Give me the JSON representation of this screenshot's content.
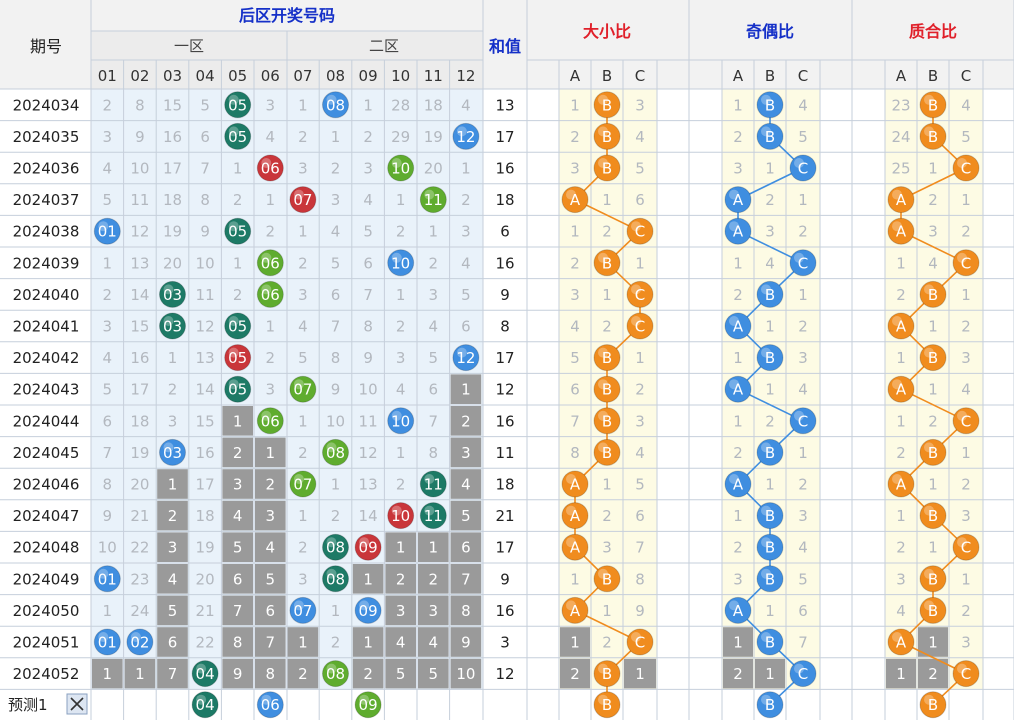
{
  "header": {
    "period": "期号",
    "back_zone": "后区开奖号码",
    "zone1": "一区",
    "zone2": "二区",
    "sum": "和值",
    "size_ratio": "大小比",
    "odd_even_ratio": "奇偶比",
    "prime_ratio": "质合比",
    "numbers": [
      "01",
      "02",
      "03",
      "04",
      "05",
      "06",
      "07",
      "08",
      "09",
      "10",
      "11",
      "12"
    ],
    "abc": [
      "A",
      "B",
      "C"
    ]
  },
  "colors": {
    "blue": "#3f8ee0",
    "teal": "#1d7a66",
    "red": "#c9363a",
    "green": "#5fac2e",
    "orange": "#f08c1e",
    "gray_cell": "#9a9a9a",
    "header_blue": "#1530c8",
    "header_red": "#e0202a",
    "number_bg": "#e9f2fa",
    "ratio_bg": "#fdfbe4"
  },
  "footer": {
    "label": "预测1",
    "close_icon": "close-icon",
    "back_balls": [
      "04",
      "06",
      "09"
    ],
    "size": "B",
    "odd_even": "B",
    "prime": "B"
  },
  "chart_data": {
    "type": "table",
    "rows": [
      {
        "period": "2024034",
        "cells": [
          "2",
          "8",
          "15",
          "5",
          "05",
          "3",
          "1",
          "08",
          "1",
          "28",
          "18",
          "4"
        ],
        "sum": "13",
        "size": [
          "1",
          "B",
          "3"
        ],
        "odd_even": [
          "1",
          "B",
          "4"
        ],
        "prime": [
          "23",
          "B",
          "4"
        ]
      },
      {
        "period": "2024035",
        "cells": [
          "3",
          "9",
          "16",
          "6",
          "05",
          "4",
          "2",
          "1",
          "2",
          "29",
          "19",
          "12"
        ],
        "sum": "17",
        "size": [
          "2",
          "B",
          "4"
        ],
        "odd_even": [
          "2",
          "B",
          "5"
        ],
        "prime": [
          "24",
          "B",
          "5"
        ]
      },
      {
        "period": "2024036",
        "cells": [
          "4",
          "10",
          "17",
          "7",
          "1",
          "06",
          "3",
          "2",
          "3",
          "10",
          "20",
          "1"
        ],
        "sum": "16",
        "size": [
          "3",
          "B",
          "5"
        ],
        "odd_even": [
          "3",
          "1",
          "C"
        ],
        "prime": [
          "25",
          "1",
          "C"
        ]
      },
      {
        "period": "2024037",
        "cells": [
          "5",
          "11",
          "18",
          "8",
          "2",
          "1",
          "07",
          "3",
          "4",
          "1",
          "11",
          "2"
        ],
        "sum": "18",
        "size": [
          "A",
          "1",
          "6"
        ],
        "odd_even": [
          "A",
          "2",
          "1"
        ],
        "prime": [
          "A",
          "2",
          "1"
        ]
      },
      {
        "period": "2024038",
        "cells": [
          "01",
          "12",
          "19",
          "9",
          "05",
          "2",
          "1",
          "4",
          "5",
          "2",
          "1",
          "3"
        ],
        "sum": "6",
        "size": [
          "1",
          "2",
          "C"
        ],
        "odd_even": [
          "A",
          "3",
          "2"
        ],
        "prime": [
          "A",
          "3",
          "2"
        ]
      },
      {
        "period": "2024039",
        "cells": [
          "1",
          "13",
          "20",
          "10",
          "1",
          "06",
          "2",
          "5",
          "6",
          "10",
          "2",
          "4"
        ],
        "sum": "16",
        "size": [
          "2",
          "B",
          "1"
        ],
        "odd_even": [
          "1",
          "4",
          "C"
        ],
        "prime": [
          "1",
          "4",
          "C"
        ]
      },
      {
        "period": "2024040",
        "cells": [
          "2",
          "14",
          "03",
          "11",
          "2",
          "06",
          "3",
          "6",
          "7",
          "1",
          "3",
          "5"
        ],
        "sum": "9",
        "size": [
          "3",
          "1",
          "C"
        ],
        "odd_even": [
          "2",
          "B",
          "1"
        ],
        "prime": [
          "2",
          "B",
          "1"
        ]
      },
      {
        "period": "2024041",
        "cells": [
          "3",
          "15",
          "03",
          "12",
          "05",
          "1",
          "4",
          "7",
          "8",
          "2",
          "4",
          "6"
        ],
        "sum": "8",
        "size": [
          "4",
          "2",
          "C"
        ],
        "odd_even": [
          "A",
          "1",
          "2"
        ],
        "prime": [
          "A",
          "1",
          "2"
        ]
      },
      {
        "period": "2024042",
        "cells": [
          "4",
          "16",
          "1",
          "13",
          "05",
          "2",
          "5",
          "8",
          "9",
          "3",
          "5",
          "12"
        ],
        "sum": "17",
        "size": [
          "5",
          "B",
          "1"
        ],
        "odd_even": [
          "1",
          "B",
          "3"
        ],
        "prime": [
          "1",
          "B",
          "3"
        ]
      },
      {
        "period": "2024043",
        "cells": [
          "5",
          "17",
          "2",
          "14",
          "05",
          "3",
          "07",
          "9",
          "10",
          "4",
          "6",
          "1"
        ],
        "sum": "12",
        "size": [
          "6",
          "B",
          "2"
        ],
        "odd_even": [
          "A",
          "1",
          "4"
        ],
        "prime": [
          "A",
          "1",
          "4"
        ]
      },
      {
        "period": "2024044",
        "cells": [
          "6",
          "18",
          "3",
          "15",
          "1",
          "06",
          "1",
          "10",
          "11",
          "10",
          "7",
          "2"
        ],
        "sum": "16",
        "size": [
          "7",
          "B",
          "3"
        ],
        "odd_even": [
          "1",
          "2",
          "C"
        ],
        "prime": [
          "1",
          "2",
          "C"
        ]
      },
      {
        "period": "2024045",
        "cells": [
          "7",
          "19",
          "03",
          "16",
          "2",
          "1",
          "2",
          "08",
          "12",
          "1",
          "8",
          "3"
        ],
        "sum": "11",
        "size": [
          "8",
          "B",
          "4"
        ],
        "odd_even": [
          "2",
          "B",
          "1"
        ],
        "prime": [
          "2",
          "B",
          "1"
        ]
      },
      {
        "period": "2024046",
        "cells": [
          "8",
          "20",
          "1",
          "17",
          "3",
          "2",
          "07",
          "1",
          "13",
          "2",
          "11",
          "4"
        ],
        "sum": "18",
        "size": [
          "A",
          "1",
          "5"
        ],
        "odd_even": [
          "A",
          "1",
          "2"
        ],
        "prime": [
          "A",
          "1",
          "2"
        ]
      },
      {
        "period": "2024047",
        "cells": [
          "9",
          "21",
          "2",
          "18",
          "4",
          "3",
          "1",
          "2",
          "14",
          "10",
          "11",
          "5"
        ],
        "sum": "21",
        "size": [
          "A",
          "2",
          "6"
        ],
        "odd_even": [
          "1",
          "B",
          "3"
        ],
        "prime": [
          "1",
          "B",
          "3"
        ]
      },
      {
        "period": "2024048",
        "cells": [
          "10",
          "22",
          "3",
          "19",
          "5",
          "4",
          "2",
          "08",
          "09",
          "1",
          "1",
          "6"
        ],
        "sum": "17",
        "size": [
          "A",
          "3",
          "7"
        ],
        "odd_even": [
          "2",
          "B",
          "4"
        ],
        "prime": [
          "2",
          "1",
          "C"
        ]
      },
      {
        "period": "2024049",
        "cells": [
          "01",
          "23",
          "4",
          "20",
          "6",
          "5",
          "3",
          "08",
          "1",
          "2",
          "2",
          "7"
        ],
        "sum": "9",
        "size": [
          "1",
          "B",
          "8"
        ],
        "odd_even": [
          "3",
          "B",
          "5"
        ],
        "prime": [
          "3",
          "B",
          "1"
        ]
      },
      {
        "period": "2024050",
        "cells": [
          "1",
          "24",
          "5",
          "21",
          "7",
          "6",
          "07",
          "1",
          "09",
          "3",
          "3",
          "8"
        ],
        "sum": "16",
        "size": [
          "A",
          "1",
          "9"
        ],
        "odd_even": [
          "A",
          "1",
          "6"
        ],
        "prime": [
          "4",
          "B",
          "2"
        ]
      },
      {
        "period": "2024051",
        "cells": [
          "01",
          "02",
          "6",
          "22",
          "8",
          "7",
          "1",
          "2",
          "1",
          "4",
          "4",
          "9"
        ],
        "sum": "3",
        "size": [
          "1",
          "2",
          "C"
        ],
        "odd_even": [
          "1",
          "B",
          "7"
        ],
        "prime": [
          "A",
          "1",
          "3"
        ]
      },
      {
        "period": "2024052",
        "cells": [
          "1",
          "1",
          "7",
          "04",
          "9",
          "8",
          "2",
          "08",
          "2",
          "5",
          "5",
          "10"
        ],
        "sum": "12",
        "size": [
          "2",
          "B",
          "1"
        ],
        "odd_even": [
          "2",
          "1",
          "C"
        ],
        "prime": [
          "1",
          "2",
          "C"
        ]
      }
    ],
    "gray_cells": [
      [
        9,
        11
      ],
      [
        10,
        4
      ],
      [
        10,
        11
      ],
      [
        11,
        4
      ],
      [
        11,
        5
      ],
      [
        11,
        11
      ],
      [
        12,
        2
      ],
      [
        12,
        4
      ],
      [
        12,
        5
      ],
      [
        12,
        11
      ],
      [
        13,
        2
      ],
      [
        13,
        4
      ],
      [
        13,
        5
      ],
      [
        13,
        11
      ],
      [
        14,
        2
      ],
      [
        14,
        4
      ],
      [
        14,
        5
      ],
      [
        14,
        9
      ],
      [
        14,
        10
      ],
      [
        14,
        11
      ],
      [
        15,
        2
      ],
      [
        15,
        4
      ],
      [
        15,
        5
      ],
      [
        15,
        8
      ],
      [
        15,
        9
      ],
      [
        15,
        10
      ],
      [
        15,
        11
      ],
      [
        16,
        2
      ],
      [
        16,
        4
      ],
      [
        16,
        5
      ],
      [
        16,
        9
      ],
      [
        16,
        10
      ],
      [
        16,
        11
      ],
      [
        17,
        2
      ],
      [
        17,
        4
      ],
      [
        17,
        5
      ],
      [
        17,
        6
      ],
      [
        17,
        8
      ],
      [
        17,
        9
      ],
      [
        17,
        10
      ],
      [
        17,
        11
      ],
      [
        18,
        0
      ],
      [
        18,
        1
      ],
      [
        18,
        2
      ],
      [
        18,
        4
      ],
      [
        18,
        5
      ],
      [
        18,
        6
      ],
      [
        18,
        8
      ],
      [
        18,
        9
      ],
      [
        18,
        10
      ],
      [
        18,
        11
      ]
    ],
    "gray_ratio": {
      "size": [
        [
          17,
          0
        ],
        [
          18,
          0
        ],
        [
          18,
          2
        ]
      ],
      "odd_even": [
        [
          17,
          0
        ],
        [
          18,
          0
        ],
        [
          18,
          1
        ]
      ],
      "prime": [
        [
          17,
          1
        ],
        [
          18,
          0
        ],
        [
          18,
          1
        ]
      ]
    }
  }
}
